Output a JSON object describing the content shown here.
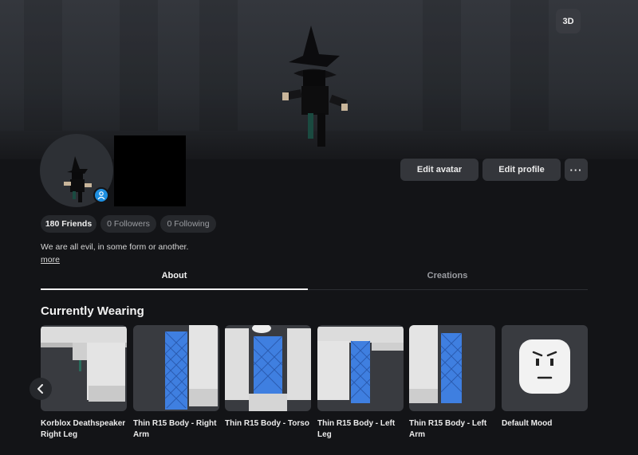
{
  "scene": {
    "toggle_3d_label": "3D"
  },
  "actions": {
    "edit_avatar": "Edit avatar",
    "edit_profile": "Edit profile",
    "more": "···"
  },
  "stats": {
    "friends": "180 Friends",
    "followers": "0 Followers",
    "following": "0 Following"
  },
  "bio": {
    "text": "We are all evil, in some form or another.",
    "more_link": "more"
  },
  "tabs": [
    {
      "label": "About",
      "active": true
    },
    {
      "label": "Creations",
      "active": false
    }
  ],
  "currently_wearing": {
    "title": "Currently Wearing",
    "items": [
      {
        "name": "Korblox Deathspeaker Right Leg",
        "icon": "korblox-leg-icon"
      },
      {
        "name": "Thin R15 Body - Right Arm",
        "icon": "right-arm-icon"
      },
      {
        "name": "Thin R15 Body - Torso",
        "icon": "torso-icon"
      },
      {
        "name": "Thin R15 Body - Left Leg",
        "icon": "left-leg-icon"
      },
      {
        "name": "Thin R15 Body - Left Arm",
        "icon": "left-arm-icon"
      },
      {
        "name": "Default Mood",
        "icon": "face-icon"
      }
    ]
  },
  "colors": {
    "background": "#131417",
    "card": "#393b40",
    "button": "#34363b",
    "accent_blue": "#3f7fe0",
    "badge_blue": "#1e8fe0"
  }
}
